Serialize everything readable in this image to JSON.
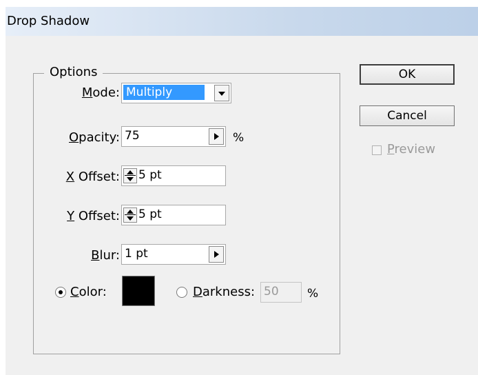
{
  "dialog": {
    "title": "Drop Shadow"
  },
  "options": {
    "legend": "Options",
    "mode": {
      "label_u": "M",
      "label_rest": "ode:",
      "value": "Multiply"
    },
    "opacity": {
      "label_u": "O",
      "label_rest": "pacity:",
      "value": "75",
      "unit": "%"
    },
    "x_offset": {
      "label_u": "X",
      "label_rest": " Offset:",
      "value": "5 pt"
    },
    "y_offset": {
      "label_u": "Y",
      "label_rest": " Offset:",
      "value": "5 pt"
    },
    "blur": {
      "label_u": "B",
      "label_rest": "lur:",
      "value": "1 pt"
    },
    "color": {
      "label_u": "C",
      "label_rest": "olor:",
      "selected": true,
      "swatch": "#000000"
    },
    "darkness": {
      "label_u": "D",
      "label_rest": "arkness:",
      "value": "50",
      "unit": "%",
      "selected": false
    }
  },
  "buttons": {
    "ok_label": "OK",
    "cancel_label": "Cancel",
    "preview": {
      "label_u": "P",
      "label_rest": "review",
      "checked": false,
      "enabled": false
    }
  }
}
